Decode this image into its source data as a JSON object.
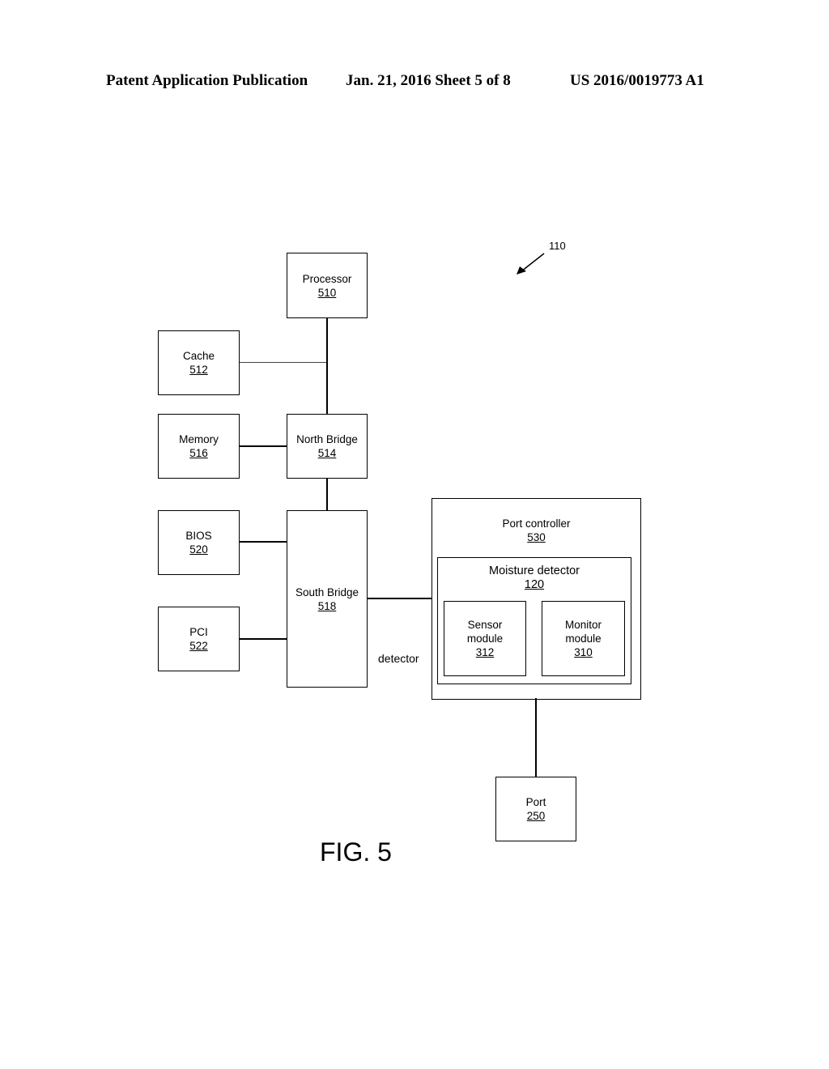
{
  "header": {
    "publication": "Patent Application Publication",
    "date_sheet": "Jan. 21, 2016  Sheet 5 of 8",
    "pub_number": "US 2016/0019773 A1"
  },
  "reference": {
    "label": "110"
  },
  "blocks": {
    "processor": {
      "label": "Processor",
      "num": "510"
    },
    "cache": {
      "label": "Cache",
      "num": "512"
    },
    "memory": {
      "label": "Memory",
      "num": "516"
    },
    "north_bridge": {
      "label": "North Bridge",
      "num": "514"
    },
    "bios": {
      "label": "BIOS",
      "num": "520"
    },
    "pci": {
      "label": "PCI",
      "num": "522"
    },
    "south_bridge": {
      "label": "South Bridge",
      "num": "518"
    },
    "port_controller": {
      "label": "Port controller",
      "num": "530"
    },
    "moisture_detector": {
      "label": "Moisture detector",
      "num": "120"
    },
    "sensor_module": {
      "label_line1": "Sensor",
      "label_line2": "module",
      "num": "312"
    },
    "monitor_module": {
      "label_line1": "Monitor",
      "label_line2": "module",
      "num": "310"
    },
    "port": {
      "label": "Port",
      "num": "250"
    }
  },
  "stray_text": "detector",
  "figure_label": "FIG. 5"
}
